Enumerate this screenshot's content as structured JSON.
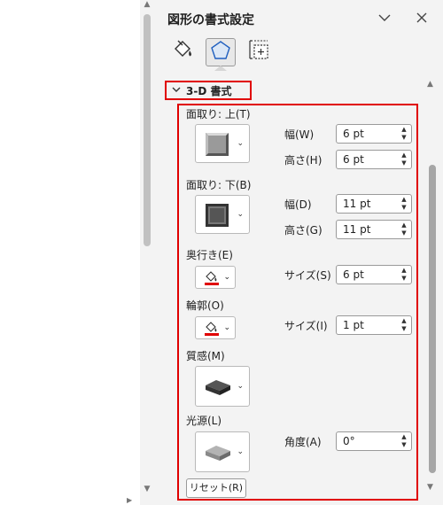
{
  "pane": {
    "title": "図形の書式設定",
    "tabs": [
      {
        "name": "fill-and-line",
        "icon": "paint-bucket-icon"
      },
      {
        "name": "effects",
        "icon": "pentagon-icon",
        "selected": true
      },
      {
        "name": "size-properties",
        "icon": "size-properties-icon"
      }
    ]
  },
  "section": {
    "title": "3-D 書式",
    "expanded": true
  },
  "bevel_top": {
    "label": "面取り: 上(T)",
    "width_label": "幅(W)",
    "width_value": "6 pt",
    "height_label": "高さ(H)",
    "height_value": "6 pt"
  },
  "bevel_bottom": {
    "label": "面取り: 下(B)",
    "width_label": "幅(D)",
    "width_value": "11 pt",
    "height_label": "高さ(G)",
    "height_value": "11 pt"
  },
  "depth": {
    "label": "奥行き(E)",
    "size_label": "サイズ(S)",
    "size_value": "6 pt",
    "color": "#e00000"
  },
  "contour": {
    "label": "輪郭(O)",
    "size_label": "サイズ(I)",
    "size_value": "1 pt",
    "color": "#e00000"
  },
  "material": {
    "label": "質感(M)"
  },
  "lighting": {
    "label": "光源(L)",
    "angle_label": "角度(A)",
    "angle_value": "0°"
  },
  "reset_label": "リセット(R)",
  "colors": {
    "highlight": "#e00000",
    "pane_bg": "#f3f3f3"
  }
}
